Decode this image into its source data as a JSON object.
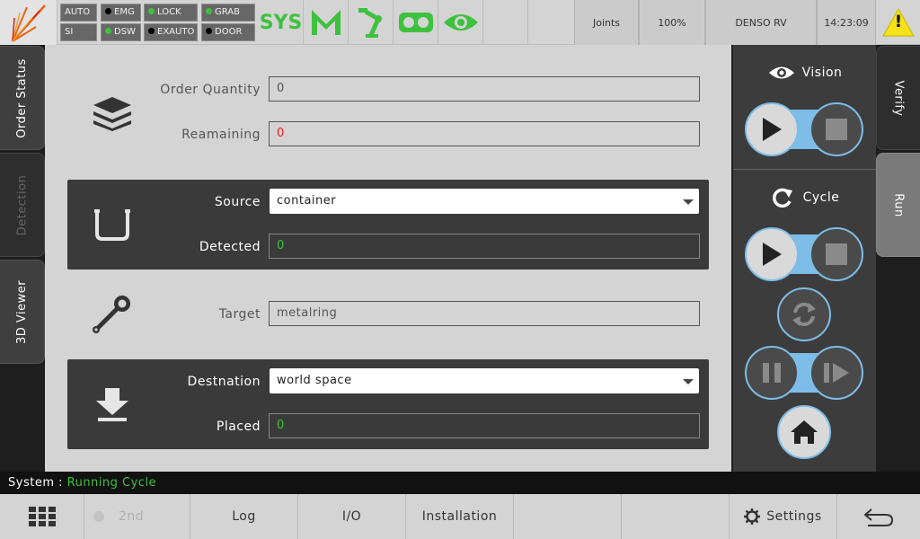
{
  "topbar": {
    "signals": [
      {
        "label": "AUTO",
        "dot": ""
      },
      {
        "label": "SI",
        "dot": ""
      },
      {
        "label": "EMG",
        "dot": "black"
      },
      {
        "label": "DSW",
        "dot": "green"
      },
      {
        "label": "LOCK",
        "dot": "green"
      },
      {
        "label": "EXAUTO",
        "dot": "black"
      },
      {
        "label": "GRAB",
        "dot": "green"
      },
      {
        "label": "DOOR",
        "dot": "black"
      }
    ],
    "sys_label": "SYS",
    "joints_label": "Joints",
    "speed": "100%",
    "robot": "DENSO RV",
    "time": "14:23:09",
    "warning_mark": "!"
  },
  "left_tabs": [
    {
      "label": "Order Status"
    },
    {
      "label": "Detection"
    },
    {
      "label": "3D Viewer"
    }
  ],
  "main": {
    "order_quantity_label": "Order Quantity",
    "order_quantity_value": "0",
    "remaining_label": "Reamaining",
    "remaining_value": "0",
    "source_label": "Source",
    "source_value": "container",
    "detected_label": "Detected",
    "detected_value": "0",
    "target_label": "Target",
    "target_value": "metalring",
    "destination_label": "Destnation",
    "destination_value": "world space",
    "placed_label": "Placed",
    "placed_value": "0"
  },
  "right_panel": {
    "vision_label": "Vision",
    "cycle_label": "Cycle"
  },
  "right_tabs": [
    {
      "label": "Verify"
    },
    {
      "label": "Run"
    }
  ],
  "status": {
    "prefix": "System : ",
    "value": "Running Cycle"
  },
  "bottom": {
    "second": "2nd",
    "log": "Log",
    "io": "I/O",
    "installation": "Installation",
    "settings": "Settings"
  },
  "colors": {
    "accent_green": "#3ec13e",
    "alert_red": "#e02020",
    "highlight_blue": "#7dbde8",
    "warning_yellow": "#f4e21a",
    "logo_orange": "#e8641a"
  }
}
